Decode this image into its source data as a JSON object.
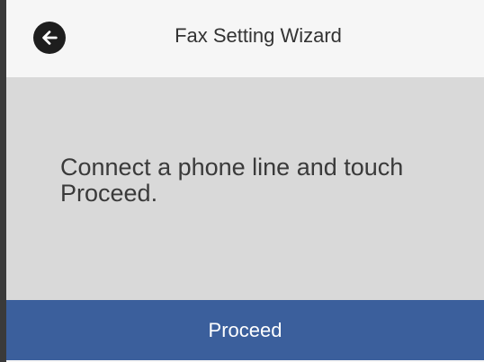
{
  "header": {
    "back_icon": "arrow-left-icon",
    "title": "Fax Setting Wizard"
  },
  "main": {
    "message": "Connect a phone line and touch Proceed."
  },
  "footer": {
    "proceed_label": "Proceed"
  },
  "colors": {
    "header_bg": "#f6f6f6",
    "content_bg": "#d9d9d9",
    "button_bg": "#3b5f9c",
    "button_text": "#ffffff",
    "back_icon_bg": "#1e1e1e"
  }
}
